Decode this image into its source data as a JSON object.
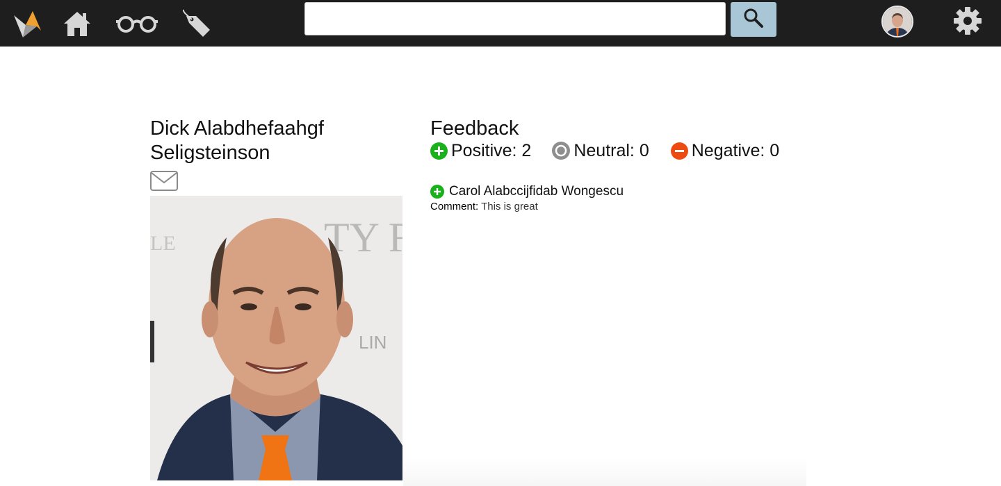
{
  "nav": {
    "search": {
      "value": "",
      "placeholder": ""
    },
    "icons": [
      "logo-icon",
      "home-icon",
      "glasses-icon",
      "tag-icon",
      "search-icon",
      "avatar",
      "gear-icon"
    ]
  },
  "profile": {
    "name": "Dick Alabdhefaahgf Seligsteinson"
  },
  "feedback": {
    "heading": "Feedback",
    "positive_label": "Positive: 2",
    "neutral_label": "Neutral: 0",
    "negative_label": "Negative: 0",
    "entries": [
      {
        "author": "Carol Alabccijfidab Wongescu",
        "comment_label": "Comment:",
        "comment": "This is great"
      }
    ]
  },
  "colors": {
    "topbar": "#1e1e1e",
    "search_button": "#a9c6d6",
    "positive": "#19b21a",
    "neutral": "#8e8e8e",
    "negative": "#ee4b13",
    "logo_orange": "#f0a030"
  }
}
